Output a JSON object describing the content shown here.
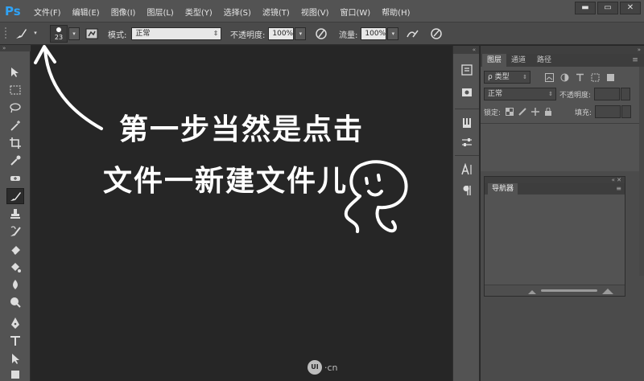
{
  "app": {
    "logo": "Ps"
  },
  "menubar": {
    "items": [
      "文件(F)",
      "编辑(E)",
      "图像(I)",
      "图层(L)",
      "类型(Y)",
      "选择(S)",
      "滤镜(T)",
      "视图(V)",
      "窗口(W)",
      "帮助(H)"
    ]
  },
  "window_controls": {
    "minimize": "▬",
    "maximize": "▭",
    "close": "✕"
  },
  "options": {
    "brush_size": "23",
    "mode_label": "模式:",
    "mode_value": "正常",
    "opacity_label": "不透明度:",
    "opacity_value": "100%",
    "flow_label": "流量:",
    "flow_value": "100%"
  },
  "layers_panel": {
    "tabs": [
      "图层",
      "通道",
      "路径"
    ],
    "filter_kind": "ρ 类型",
    "blend_mode": "正常",
    "opacity_label": "不透明度:",
    "lock_label": "锁定:",
    "fill_label": "填充:"
  },
  "navigator_panel": {
    "tab": "导航器"
  },
  "annotation": {
    "line1": "第一步当然是点击",
    "line2": "文件一新建文件儿"
  },
  "watermark": {
    "badge": "UI",
    "text": "·cn"
  }
}
